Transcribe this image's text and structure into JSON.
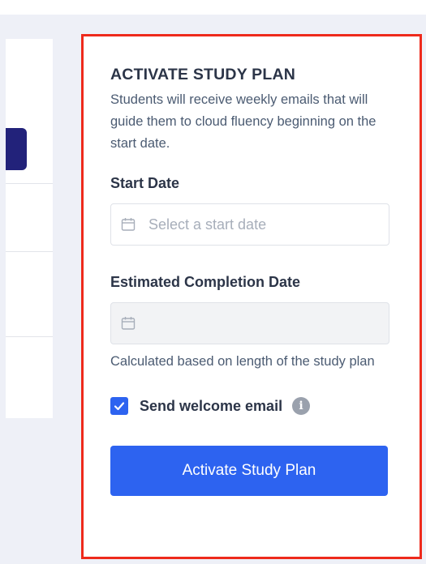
{
  "panel": {
    "title": "ACTIVATE STUDY PLAN",
    "description": "Students will receive weekly emails that will guide them to cloud fluency beginning on the start date.",
    "start_date": {
      "label": "Start Date",
      "placeholder": "Select a start date",
      "value": "",
      "icon": "calendar-icon"
    },
    "completion_date": {
      "label": "Estimated Completion Date",
      "value": "",
      "icon": "calendar-icon",
      "help": "Calculated based on length of the study plan"
    },
    "welcome_email": {
      "label": "Send welcome email",
      "checked": true,
      "info_icon": "info-icon"
    },
    "submit_label": "Activate Study Plan"
  },
  "colors": {
    "accent": "#2d63f0",
    "highlight_border": "#ee2a1c",
    "title_text": "#2c3548",
    "body_text": "#4b5b72",
    "background": "#eef0f7",
    "left_button": "#22227a"
  }
}
